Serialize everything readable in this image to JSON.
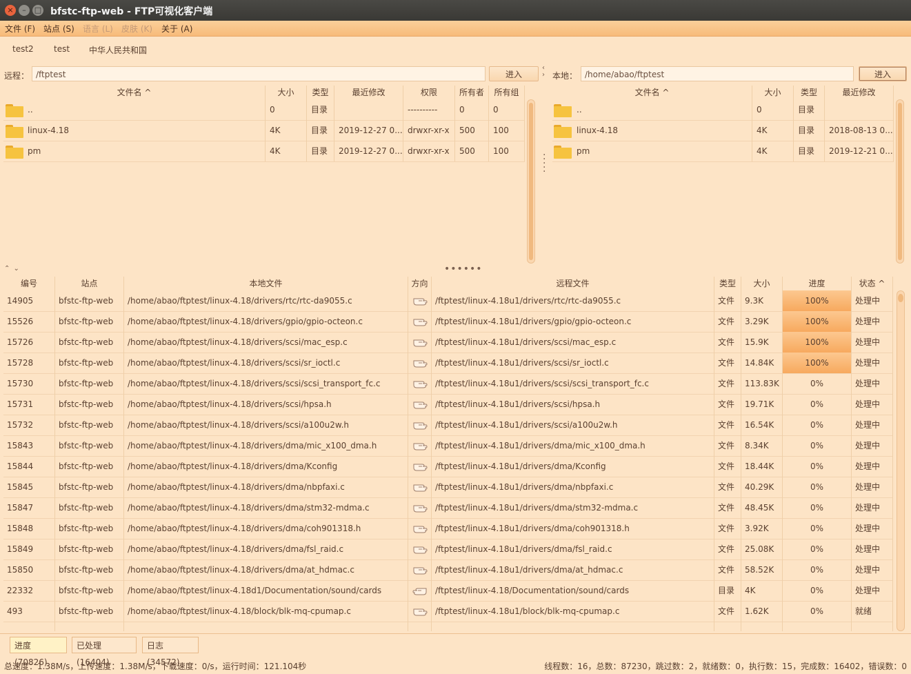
{
  "window": {
    "title": "bfstc-ftp-web - FTP可视化客户端"
  },
  "menu": [
    {
      "label": "文件 (F)",
      "disabled": false
    },
    {
      "label": "站点 (S)",
      "disabled": false
    },
    {
      "label": "语言 (L)",
      "disabled": true
    },
    {
      "label": "皮肤 (K)",
      "disabled": true
    },
    {
      "label": "关于 (A)",
      "disabled": false
    }
  ],
  "site_tabs": [
    "test2",
    "test",
    "中华人民共和国"
  ],
  "remote": {
    "label": "远程：",
    "path": "/ftptest",
    "enter": "进入",
    "columns": [
      "文件名 ^",
      "大小",
      "类型",
      "最近修改",
      "权限",
      "所有者",
      "所有组"
    ],
    "rows": [
      [
        "..",
        "0",
        "目录",
        "",
        "----------",
        "0",
        "0"
      ],
      [
        "linux-4.18",
        "4K",
        "目录",
        "2019-12-27 0...",
        "drwxr-xr-x",
        "500",
        "100"
      ],
      [
        "pm",
        "4K",
        "目录",
        "2019-12-27 0...",
        "drwxr-xr-x",
        "500",
        "100"
      ]
    ]
  },
  "local": {
    "label": "本地：",
    "path": "/home/abao/ftptest",
    "enter": "进入",
    "columns": [
      "文件名 ^",
      "大小",
      "类型",
      "最近修改"
    ],
    "rows": [
      [
        "..",
        "0",
        "目录",
        ""
      ],
      [
        "linux-4.18",
        "4K",
        "目录",
        "2018-08-13 0..."
      ],
      [
        "pm",
        "4K",
        "目录",
        "2019-12-21 0..."
      ]
    ]
  },
  "tasks": {
    "columns": [
      "编号",
      "站点",
      "本地文件",
      "方向",
      "远程文件",
      "类型",
      "大小",
      "进度",
      "状态 ^"
    ],
    "rows": [
      [
        "14905",
        "bfstc-ftp-web",
        "/home/abao/ftptest/linux-4.18/drivers/rtc/rtc-da9055.c",
        "upload",
        "/ftptest/linux-4.18u1/drivers/rtc/rtc-da9055.c",
        "文件",
        "9.3K",
        "100%",
        "处理中"
      ],
      [
        "15526",
        "bfstc-ftp-web",
        "/home/abao/ftptest/linux-4.18/drivers/gpio/gpio-octeon.c",
        "upload",
        "/ftptest/linux-4.18u1/drivers/gpio/gpio-octeon.c",
        "文件",
        "3.29K",
        "100%",
        "处理中"
      ],
      [
        "15726",
        "bfstc-ftp-web",
        "/home/abao/ftptest/linux-4.18/drivers/scsi/mac_esp.c",
        "upload",
        "/ftptest/linux-4.18u1/drivers/scsi/mac_esp.c",
        "文件",
        "15.9K",
        "100%",
        "处理中"
      ],
      [
        "15728",
        "bfstc-ftp-web",
        "/home/abao/ftptest/linux-4.18/drivers/scsi/sr_ioctl.c",
        "upload",
        "/ftptest/linux-4.18u1/drivers/scsi/sr_ioctl.c",
        "文件",
        "14.84K",
        "100%",
        "处理中"
      ],
      [
        "15730",
        "bfstc-ftp-web",
        "/home/abao/ftptest/linux-4.18/drivers/scsi/scsi_transport_fc.c",
        "upload",
        "/ftptest/linux-4.18u1/drivers/scsi/scsi_transport_fc.c",
        "文件",
        "113.83K",
        "0%",
        "处理中"
      ],
      [
        "15731",
        "bfstc-ftp-web",
        "/home/abao/ftptest/linux-4.18/drivers/scsi/hpsa.h",
        "upload",
        "/ftptest/linux-4.18u1/drivers/scsi/hpsa.h",
        "文件",
        "19.71K",
        "0%",
        "处理中"
      ],
      [
        "15732",
        "bfstc-ftp-web",
        "/home/abao/ftptest/linux-4.18/drivers/scsi/a100u2w.h",
        "upload",
        "/ftptest/linux-4.18u1/drivers/scsi/a100u2w.h",
        "文件",
        "16.54K",
        "0%",
        "处理中"
      ],
      [
        "15843",
        "bfstc-ftp-web",
        "/home/abao/ftptest/linux-4.18/drivers/dma/mic_x100_dma.h",
        "upload",
        "/ftptest/linux-4.18u1/drivers/dma/mic_x100_dma.h",
        "文件",
        "8.34K",
        "0%",
        "处理中"
      ],
      [
        "15844",
        "bfstc-ftp-web",
        "/home/abao/ftptest/linux-4.18/drivers/dma/Kconfig",
        "upload",
        "/ftptest/linux-4.18u1/drivers/dma/Kconfig",
        "文件",
        "18.44K",
        "0%",
        "处理中"
      ],
      [
        "15845",
        "bfstc-ftp-web",
        "/home/abao/ftptest/linux-4.18/drivers/dma/nbpfaxi.c",
        "upload",
        "/ftptest/linux-4.18u1/drivers/dma/nbpfaxi.c",
        "文件",
        "40.29K",
        "0%",
        "处理中"
      ],
      [
        "15847",
        "bfstc-ftp-web",
        "/home/abao/ftptest/linux-4.18/drivers/dma/stm32-mdma.c",
        "upload",
        "/ftptest/linux-4.18u1/drivers/dma/stm32-mdma.c",
        "文件",
        "48.45K",
        "0%",
        "处理中"
      ],
      [
        "15848",
        "bfstc-ftp-web",
        "/home/abao/ftptest/linux-4.18/drivers/dma/coh901318.h",
        "upload",
        "/ftptest/linux-4.18u1/drivers/dma/coh901318.h",
        "文件",
        "3.92K",
        "0%",
        "处理中"
      ],
      [
        "15849",
        "bfstc-ftp-web",
        "/home/abao/ftptest/linux-4.18/drivers/dma/fsl_raid.c",
        "upload",
        "/ftptest/linux-4.18u1/drivers/dma/fsl_raid.c",
        "文件",
        "25.08K",
        "0%",
        "处理中"
      ],
      [
        "15850",
        "bfstc-ftp-web",
        "/home/abao/ftptest/linux-4.18/drivers/dma/at_hdmac.c",
        "upload",
        "/ftptest/linux-4.18u1/drivers/dma/at_hdmac.c",
        "文件",
        "58.52K",
        "0%",
        "处理中"
      ],
      [
        "22332",
        "bfstc-ftp-web",
        "/home/abao/ftptest/linux-4.18d1/Documentation/sound/cards",
        "download",
        "/ftptest/linux-4.18/Documentation/sound/cards",
        "目录",
        "4K",
        "0%",
        "处理中"
      ],
      [
        "493",
        "bfstc-ftp-web",
        "/home/abao/ftptest/linux-4.18/block/blk-mq-cpumap.c",
        "upload",
        "/ftptest/linux-4.18u1/block/blk-mq-cpumap.c",
        "文件",
        "1.62K",
        "0%",
        "就绪"
      ]
    ]
  },
  "bottom_tabs": [
    "进度(70826)",
    "已处理(16404)",
    "日志(34572)"
  ],
  "status": {
    "left": "总速度：1.38M/s，上传速度：1.38M/s，下载速度：0/s，运行时间：121.104秒",
    "right": "线程数：16，总数：87230，跳过数：2，就绪数：0，执行数：15，完成数：16402，错误数：0"
  },
  "colors": {
    "background": "#fde4c6",
    "accent": "#f7a95e",
    "titlebar": "#3c3b37"
  }
}
